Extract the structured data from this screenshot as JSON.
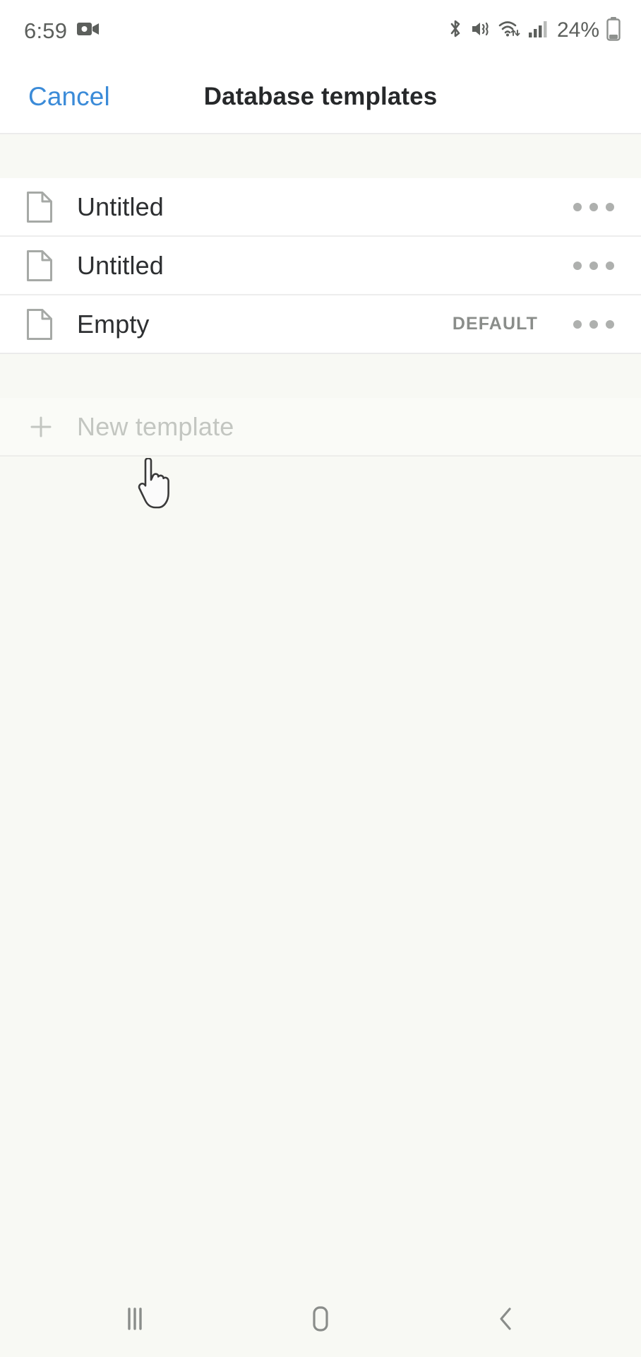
{
  "status_bar": {
    "time": "6:59",
    "battery_percent": "24%",
    "icons": [
      "video-camera-icon",
      "bluetooth-icon",
      "vibrate-mute-icon",
      "wifi-icon",
      "cellular-signal-icon",
      "battery-icon"
    ]
  },
  "header": {
    "cancel_label": "Cancel",
    "title": "Database templates",
    "accent_color": "#3b8bd8"
  },
  "templates": [
    {
      "label": "Untitled",
      "badge": "",
      "icon": "document-icon",
      "more": "more-options-icon"
    },
    {
      "label": "Untitled",
      "badge": "",
      "icon": "document-icon",
      "more": "more-options-icon"
    },
    {
      "label": "Empty",
      "badge": "DEFAULT",
      "icon": "document-icon",
      "more": "more-options-icon"
    }
  ],
  "new_template": {
    "label": "New template",
    "plus_icon": "plus-icon"
  },
  "nav_bar": {
    "recents_label": "recents-icon",
    "home_label": "home-icon",
    "back_label": "back-icon"
  },
  "cursor": {
    "type": "pointing-hand-cursor"
  }
}
